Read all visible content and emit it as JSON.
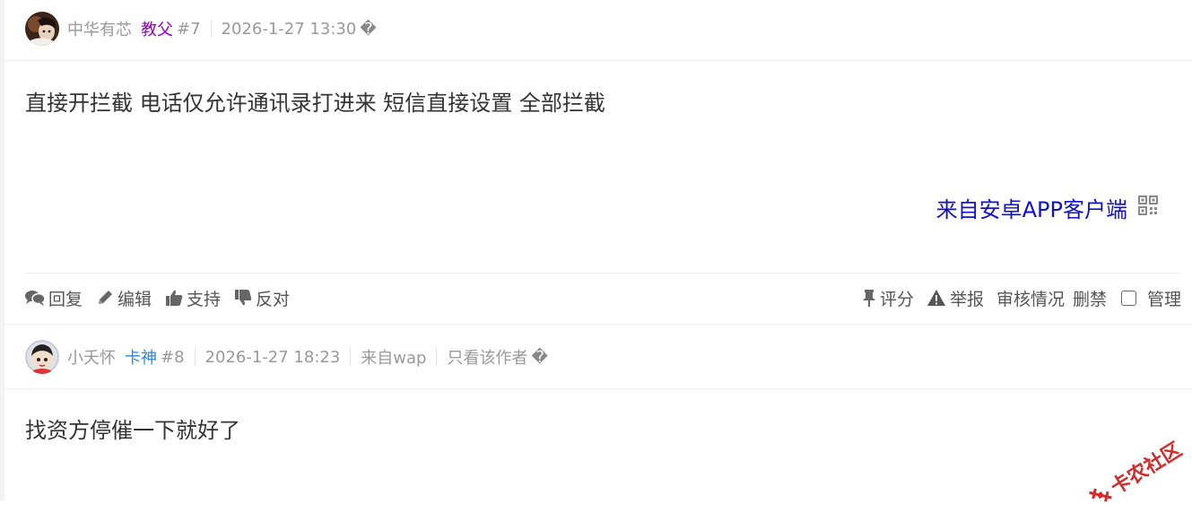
{
  "posts": [
    {
      "username": "中华有芯",
      "rank": "教父",
      "rank_color": "#9900cc",
      "floor": "#7",
      "time": "2026-1-27 13:30",
      "extra_icon": "�",
      "content": "直接开拦截 电话仅允许通讯录打进来 短信直接设置 全部拦截",
      "from_app": "来自安卓APP客户端"
    },
    {
      "username": "小夭怀",
      "rank": "卡神",
      "rank_color": "#2b8ad8",
      "floor": "#8",
      "time": "2026-1-27 18:23",
      "source": "来自wap",
      "only_author": "只看该作者",
      "extra_icon": "�",
      "content": "找资方停催一下就好了"
    }
  ],
  "actions": {
    "reply": "回复",
    "edit": "编辑",
    "support": "支持",
    "oppose": "反对",
    "rate": "评分",
    "report": "举报",
    "review": "审核情况",
    "ban": "删禁",
    "manage": "管理"
  },
  "watermark": "卡农社区",
  "icons": {
    "reply": "chat-bubbles-icon",
    "edit": "pencil-icon",
    "support": "thumbs-up-icon",
    "oppose": "thumbs-down-icon",
    "rate": "pin-icon",
    "report": "warning-icon",
    "qr": "qr-code-icon"
  }
}
